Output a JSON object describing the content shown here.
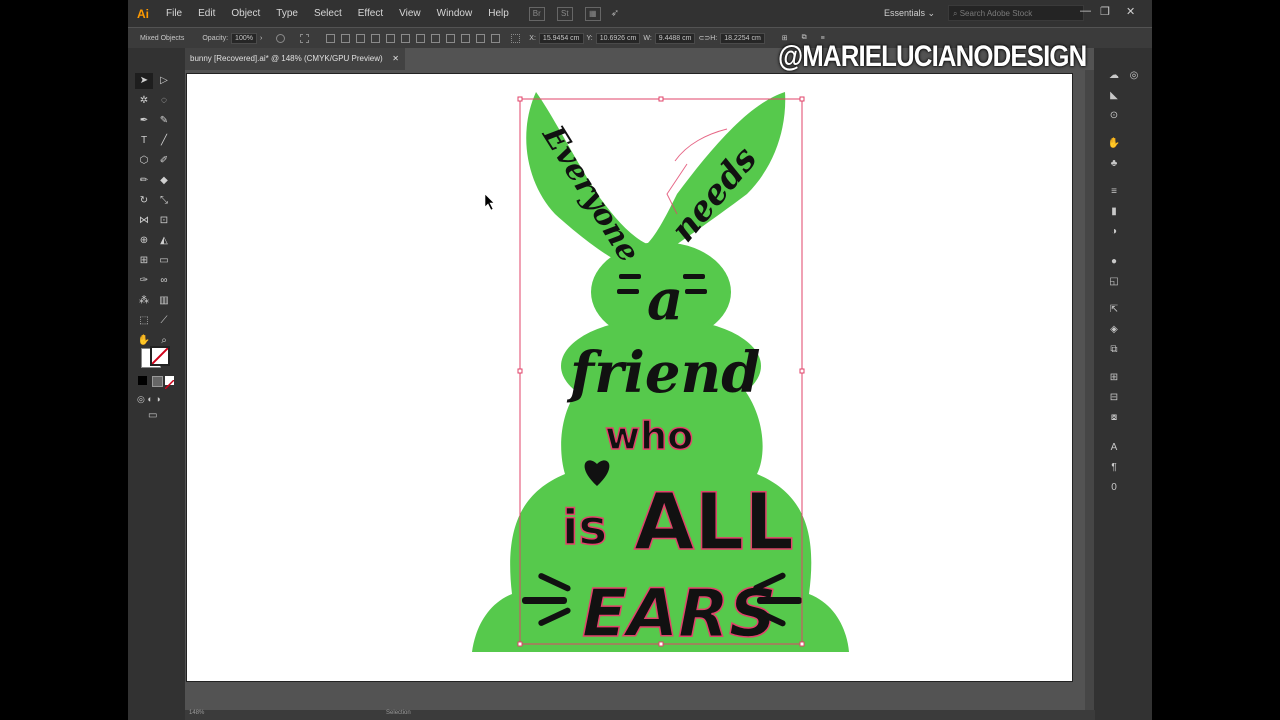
{
  "app": {
    "logo": "Ai",
    "menus": [
      "File",
      "Edit",
      "Object",
      "Type",
      "Select",
      "Effect",
      "View",
      "Window",
      "Help"
    ],
    "bridge_label": "St",
    "workspace": "Essentials",
    "stock_search_placeholder": "Search Adobe Stock",
    "window_controls": [
      "—",
      "❐",
      "✕"
    ]
  },
  "control_bar": {
    "selection_type": "Mixed Objects",
    "opacity_label": "Opacity:",
    "opacity_value": "100%",
    "x_label": "X:",
    "x_value": "15.9454 cm",
    "y_label": "Y:",
    "y_value": "10.6926 cm",
    "w_label": "W:",
    "w_value": "9.4488 cm",
    "h_label": "H:",
    "h_value": "18.2254 cm"
  },
  "document": {
    "tab_title": "bunny [Recovered].ai* @ 148% (CMYK/GPU Preview)",
    "close": "✕"
  },
  "artwork": {
    "words": [
      "Everyone",
      "needs",
      "a",
      "friend",
      "who",
      "is",
      "ALL",
      "EARS"
    ],
    "fill_color": "#56c94c",
    "text_color": "#111111",
    "outline_color": "#e0436a"
  },
  "watermark": "@MARIELUCIANODESIGN",
  "status": {
    "zoom": "148%",
    "tool": "Selection"
  },
  "colors": {
    "app_bg": "#535353",
    "panel_bg": "#323232",
    "accent": "#ff9a00"
  }
}
